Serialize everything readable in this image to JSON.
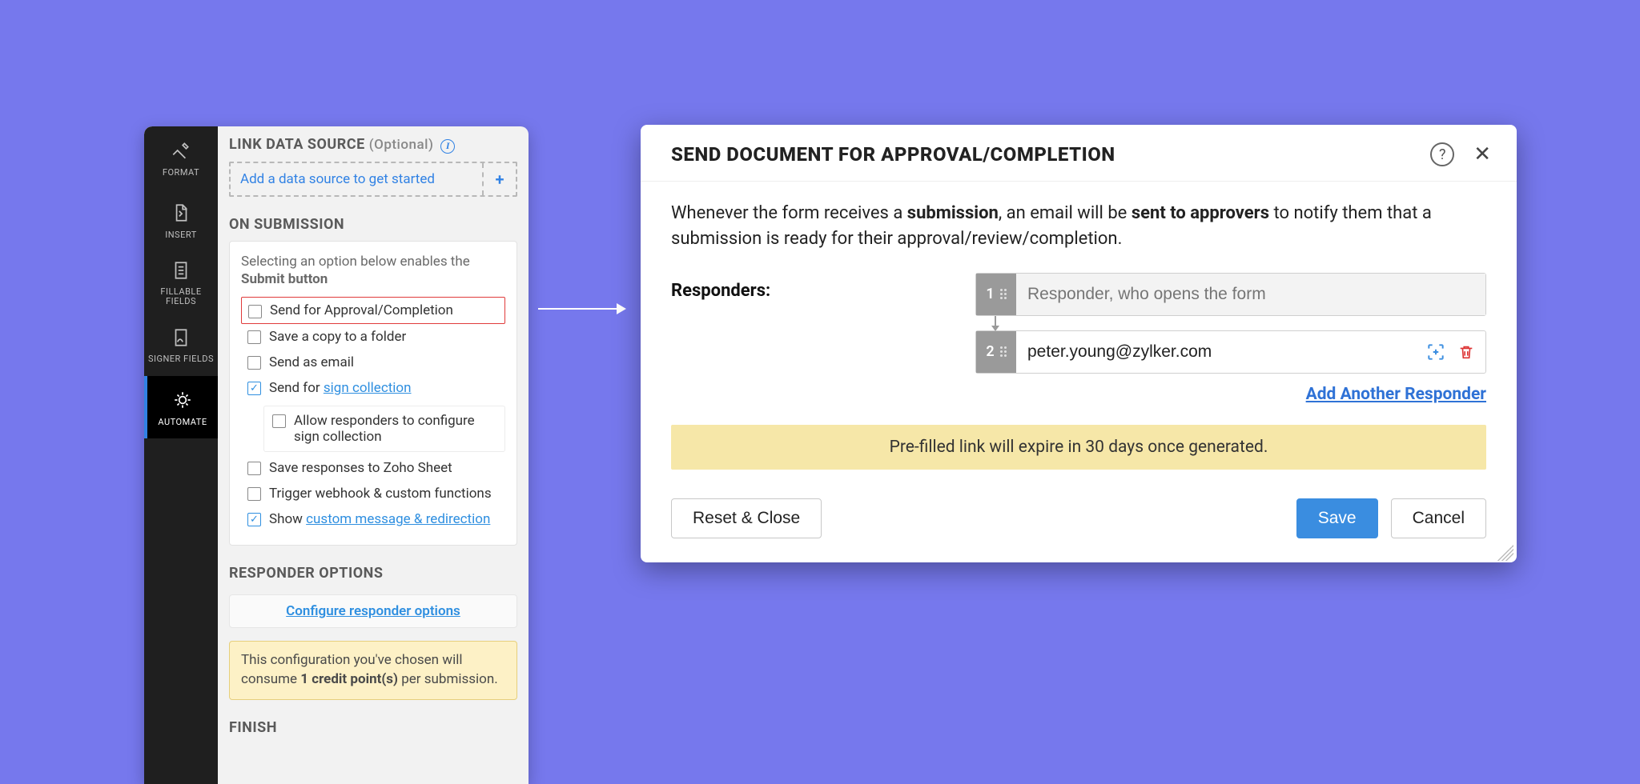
{
  "nav": {
    "items": [
      {
        "label": "FORMAT",
        "icon": "format"
      },
      {
        "label": "INSERT",
        "icon": "insert"
      },
      {
        "label": "FILLABLE FIELDS",
        "icon": "fillable"
      },
      {
        "label": "SIGNER FIELDS",
        "icon": "signer"
      },
      {
        "label": "AUTOMATE",
        "icon": "automate",
        "active": true
      }
    ]
  },
  "panel": {
    "link_ds_title": "LINK DATA SOURCE",
    "link_ds_optional": "(Optional)",
    "add_ds": "Add a data source to get started",
    "on_submission_title": "ON SUBMISSION",
    "submission_intro_pre": "Selecting an option below enables the ",
    "submission_intro_bold": "Submit button",
    "opts": {
      "send_approval": "Send for Approval/Completion",
      "save_copy": "Save a copy to a folder",
      "send_email": "Send as email",
      "send_for": "Send for ",
      "sign_collection_link": "sign collection",
      "allow_responders": "Allow responders to configure sign collection",
      "save_zoho_sheet": "Save responses to Zoho Sheet",
      "trigger_webhook": "Trigger webhook & custom functions",
      "show": "Show ",
      "custom_msg_link": "custom message & redirection"
    },
    "responder_options_title": "RESPONDER OPTIONS",
    "configure_responder": "Configure responder options",
    "credit_pre": "This configuration you've chosen will consume ",
    "credit_bold": "1 credit point(s)",
    "credit_post": " per submission.",
    "finish_title": "FINISH"
  },
  "dialog": {
    "title": "SEND DOCUMENT FOR APPROVAL/COMPLETION",
    "intro_1": "Whenever the form receives a ",
    "intro_b1": "submission",
    "intro_2": ", an email will be ",
    "intro_b2": "sent to approvers",
    "intro_3": " to notify them that a submission is ready for their approval/review/completion.",
    "responders_label": "Responders:",
    "rows": [
      {
        "num": "1",
        "placeholder": "Responder, who opens the form",
        "value": "",
        "readonly": true
      },
      {
        "num": "2",
        "placeholder": "",
        "value": "peter.young@zylker.com",
        "readonly": false
      }
    ],
    "add_another": "Add Another Responder",
    "expire_note": "Pre-filled link will expire in 30 days once generated.",
    "reset_close": "Reset & Close",
    "save": "Save",
    "cancel": "Cancel"
  }
}
